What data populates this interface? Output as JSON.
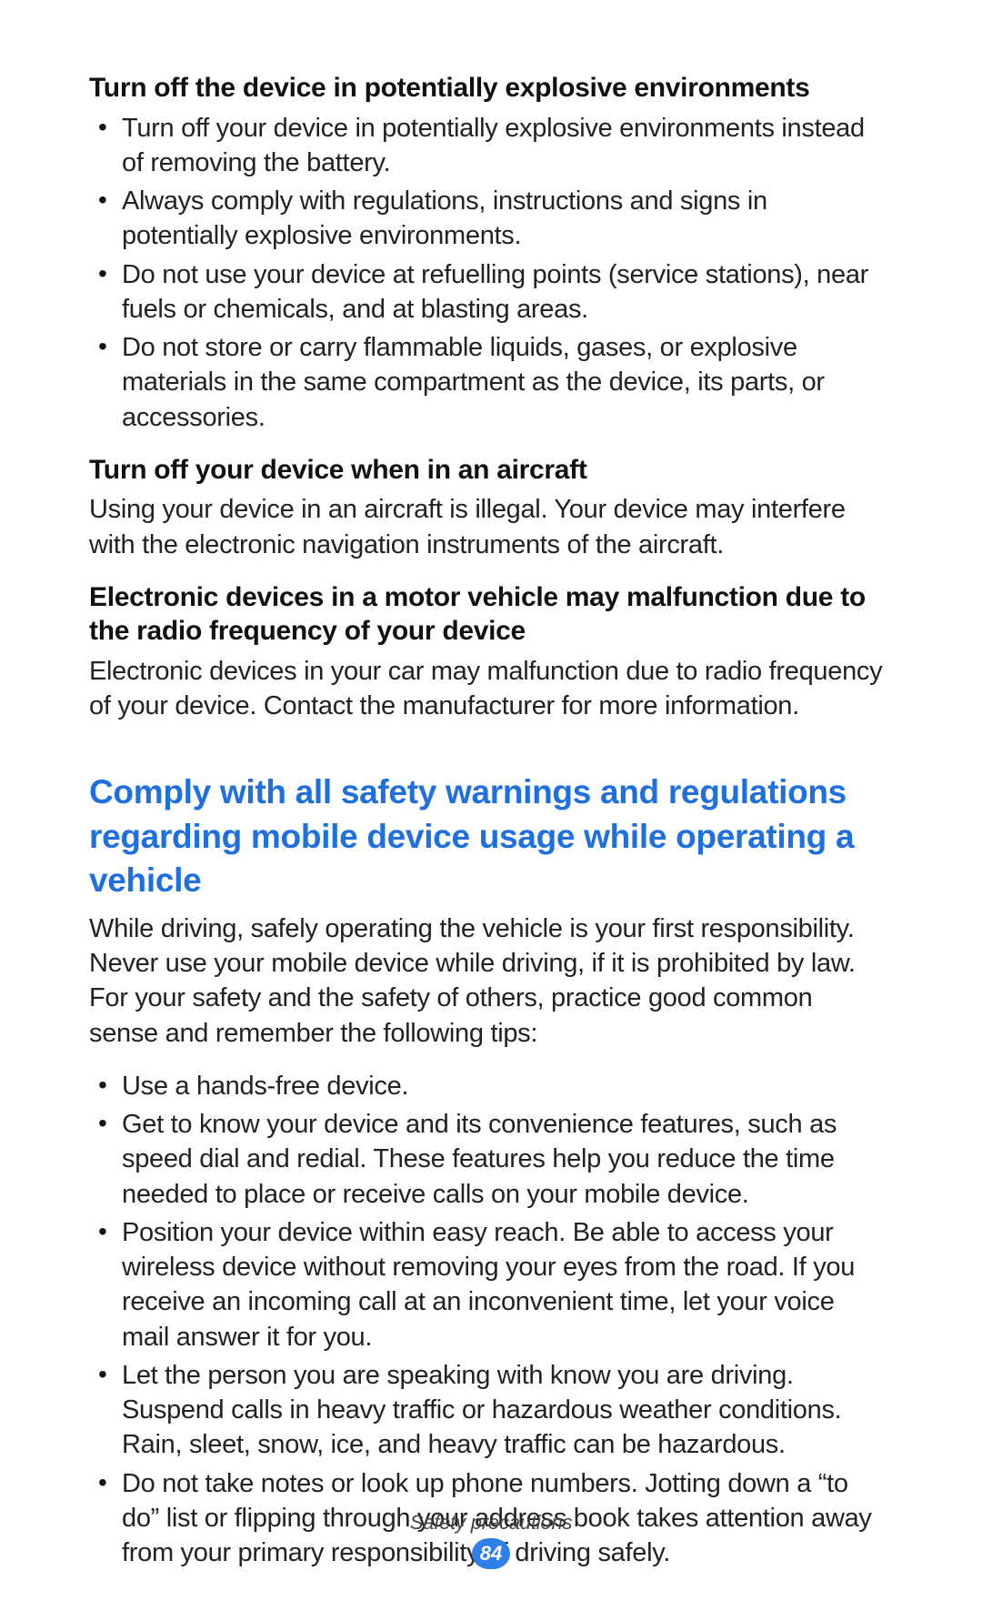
{
  "sections": [
    {
      "heading": "Turn off the device in potentially explosive environments",
      "bullets": [
        "Turn off your device in potentially explosive environments instead of removing the battery.",
        "Always comply with regulations, instructions and signs in potentially explosive environments.",
        "Do not use your device at refuelling points (service stations), near fuels or chemicals, and at blasting areas.",
        "Do not store or carry flammable liquids, gases, or explosive materials in the same compartment as the device, its parts, or accessories."
      ]
    },
    {
      "heading": "Turn off your device when in an aircraft",
      "paragraph": "Using your device in an aircraft is illegal. Your device may interfere with the electronic navigation instruments of the aircraft."
    },
    {
      "heading": "Electronic devices in a motor vehicle may malfunction due to the radio frequency of your device",
      "paragraph": "Electronic devices in your car may malfunction due to radio frequency of your device. Contact the manufacturer for more information."
    }
  ],
  "blue_heading": "Comply with all safety warnings and regulations regarding mobile device usage while operating a vehicle",
  "blue_paragraph": "While driving, safely operating the vehicle is your first responsibility. Never use your mobile device while driving, if it is prohibited by law. For your safety and the safety of others, practice good common sense and remember the following tips:",
  "blue_bullets": [
    "Use a hands-free device.",
    "Get to know your device and its convenience features, such as speed dial and redial. These features help you reduce the time needed to place or receive calls on your mobile device.",
    "Position your device within easy reach. Be able to access your wireless device without removing your eyes from the road. If you receive an incoming call at an inconvenient time, let your voice mail answer it for you.",
    "Let the person you are speaking with know you are driving. Suspend calls in heavy traffic or hazardous weather conditions. Rain, sleet, snow, ice, and heavy traffic can be hazardous.",
    "Do not take notes or look up phone numbers. Jotting down a “to do” list or flipping through your address book takes attention away from your primary responsibility of driving safely."
  ],
  "footer": {
    "section_title": "Safety precautions",
    "page_number": "84"
  }
}
